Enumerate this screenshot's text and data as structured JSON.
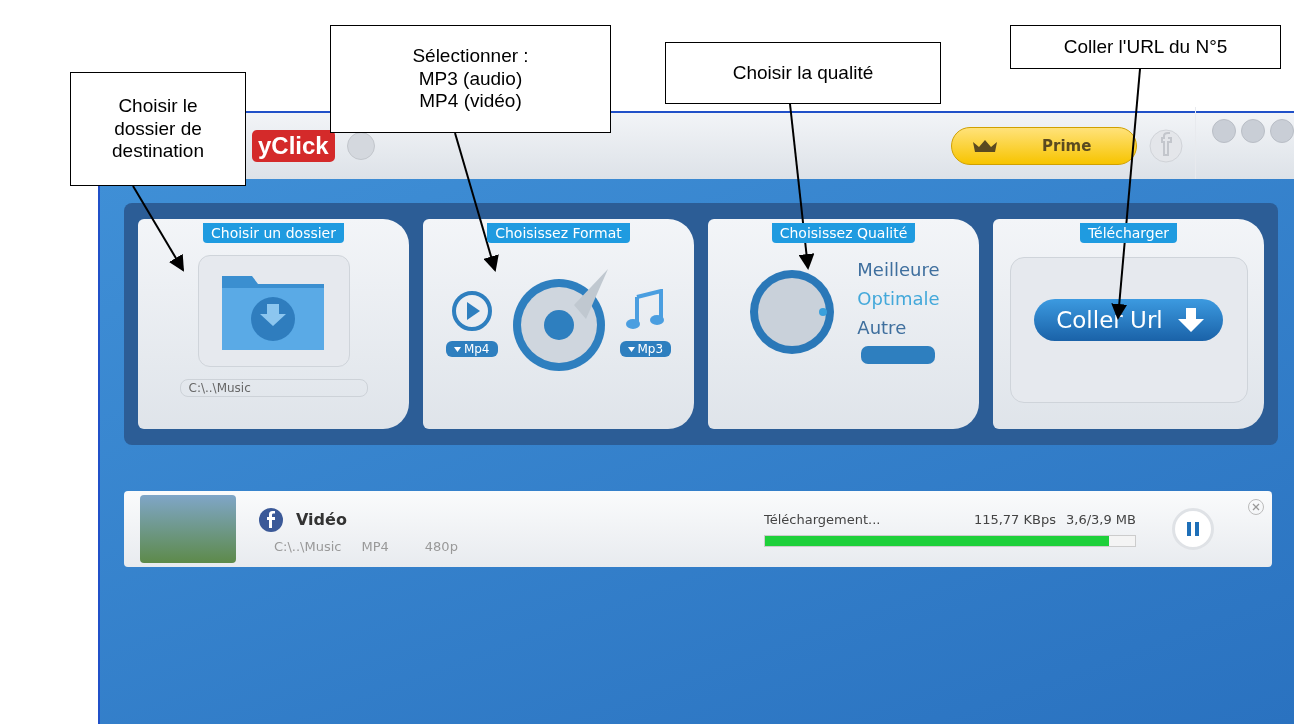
{
  "window": {
    "logo": "yClick",
    "prime_button": "Prime"
  },
  "sections": [
    {
      "kind": "folder",
      "tab": "Choisir un dossier",
      "path": "C:\\..\\Music"
    },
    {
      "kind": "format",
      "tab": "Choisissez Format",
      "options": [
        {
          "label": "Mp4"
        },
        {
          "label": "Mp3"
        }
      ]
    },
    {
      "kind": "quality",
      "tab": "Choisissez Qualité",
      "options": [
        {
          "label": "Meilleure",
          "selected": false
        },
        {
          "label": "Optimale",
          "selected": true
        },
        {
          "label": "Autre",
          "selected": false
        }
      ]
    },
    {
      "kind": "download",
      "tab": "Télécharger",
      "button": "Coller Url"
    }
  ],
  "downloads": [
    {
      "title": "Vidéo",
      "path": "C:\\..\\Music",
      "format": "MP4",
      "resolution": "480p",
      "status": "Téléchargement...",
      "speed": "115,77 KBps",
      "size": "3,6/3,9 MB",
      "level": 0.93
    }
  ],
  "callouts": [
    {
      "lines": [
        "Choisir le",
        "dossier de",
        "destination"
      ]
    },
    {
      "lines": [
        "Sélectionner :",
        "MP3 (audio)",
        "MP4 (vidéo)"
      ]
    },
    {
      "lines": [
        "Choisir la qualité"
      ]
    },
    {
      "lines": [
        "Coller l'URL du N°5"
      ]
    }
  ]
}
